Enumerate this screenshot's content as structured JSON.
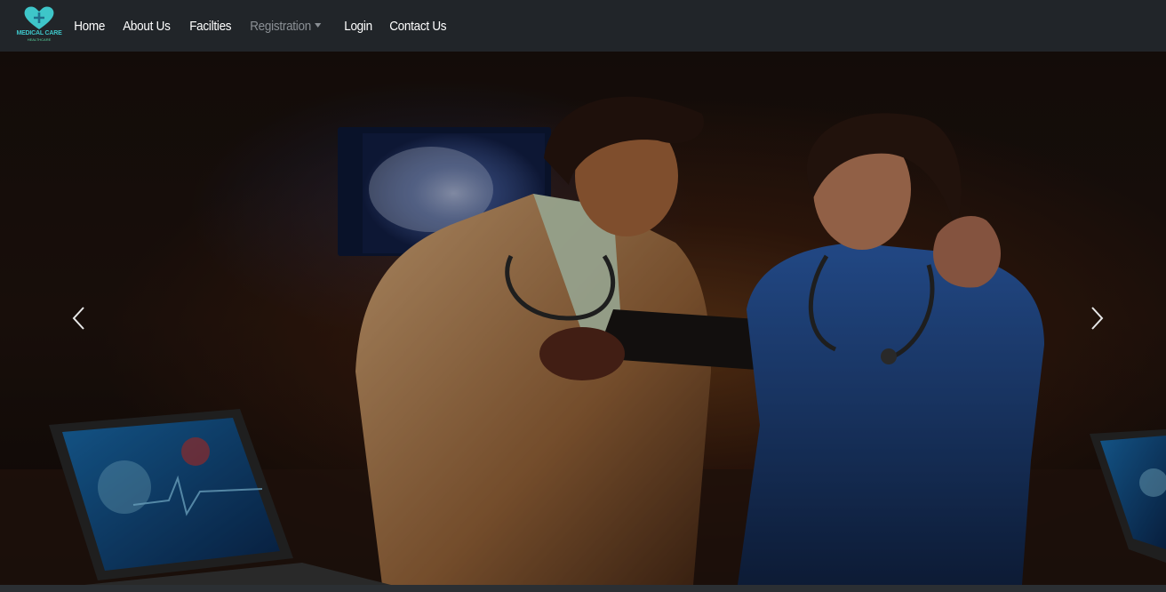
{
  "brand": {
    "name": "MEDICAL CARE",
    "tagline": "HEALTHCARE",
    "accent": "#3ec6c9"
  },
  "nav": {
    "items": [
      {
        "label": "Home"
      },
      {
        "label": "About Us"
      },
      {
        "label": "Facilties"
      },
      {
        "label": "Registration"
      },
      {
        "label": "Login"
      },
      {
        "label": "Contact Us"
      }
    ]
  },
  "carousel": {
    "prev_icon": "chevron-left-icon",
    "next_icon": "chevron-right-icon",
    "slide": "doctor-and-nurse-reviewing-tablet"
  },
  "colors": {
    "navbar_bg": "#212529",
    "nav_text": "#ffffff",
    "nav_muted": "#8a8f94"
  }
}
